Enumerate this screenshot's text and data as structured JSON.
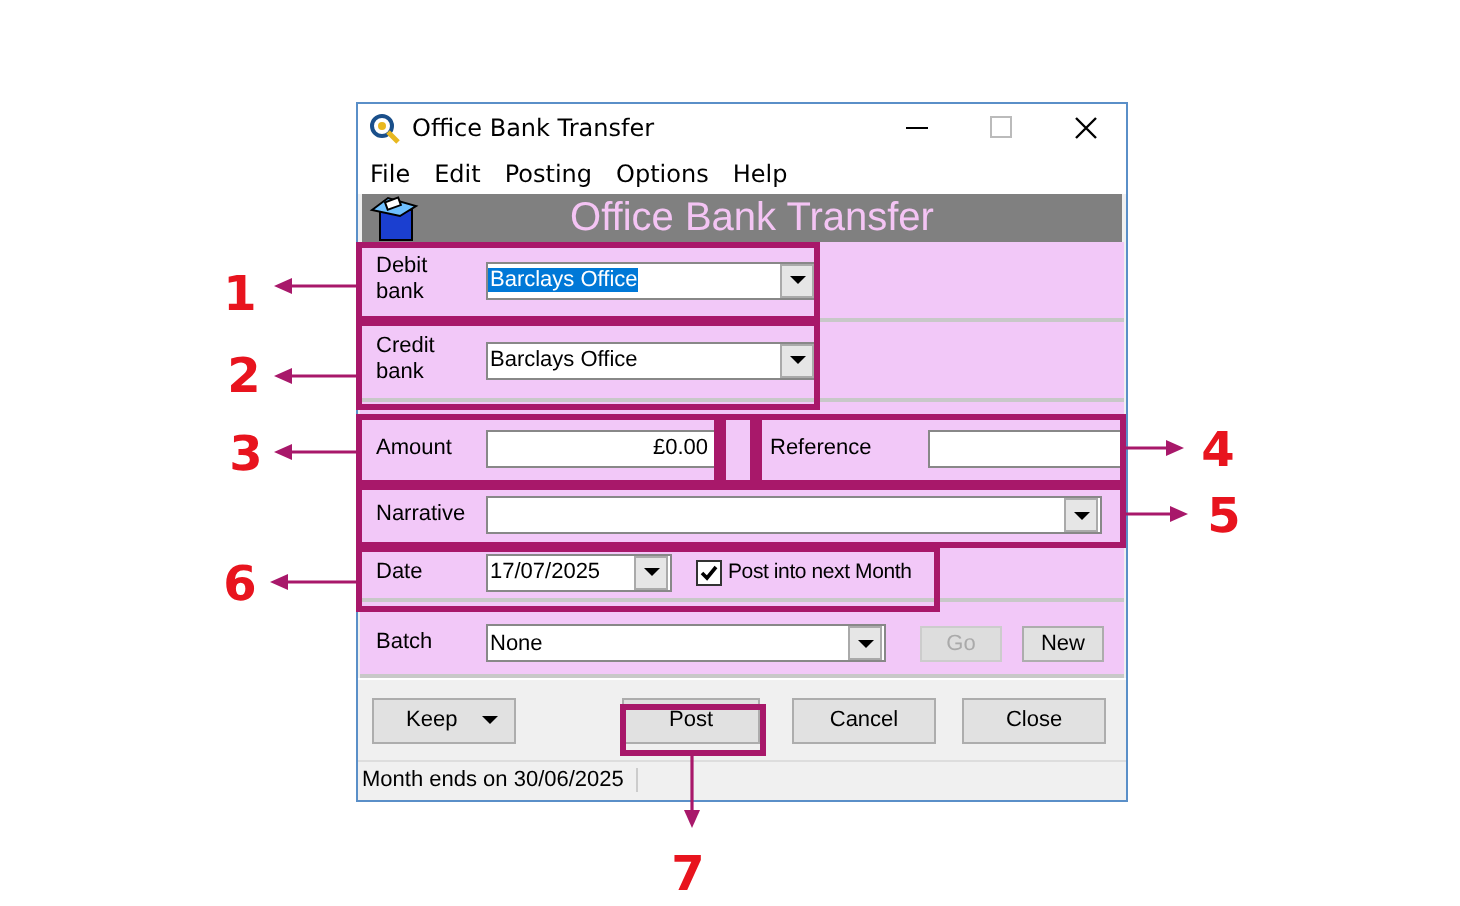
{
  "window": {
    "title": "Office Bank Transfer"
  },
  "menu": [
    "File",
    "Edit",
    "Posting",
    "Options",
    "Help"
  ],
  "banner": {
    "title": "Office Bank Transfer"
  },
  "debit_bank": {
    "label": "Debit bank",
    "value": "Barclays Office",
    "highlighted": true
  },
  "credit_bank": {
    "label": "Credit bank",
    "value": "Barclays Office",
    "highlighted": false
  },
  "amount": {
    "label": "Amount",
    "value": "£0.00"
  },
  "reference": {
    "label": "Reference"
  },
  "narrative": {
    "label": "Narrative"
  },
  "date": {
    "label": "Date",
    "value": "17/07/2025"
  },
  "post_next_month": {
    "label": "Post into next Month",
    "checked": true
  },
  "batch": {
    "label": "Batch",
    "value": "None"
  },
  "batch_buttons": [
    {
      "label": "Go",
      "disabled": true
    },
    {
      "label": "New",
      "disabled": false
    }
  ],
  "buttons": [
    {
      "label": "Keep",
      "kind": "split"
    },
    {
      "label": "Post",
      "kind": "plain"
    },
    {
      "label": "Cancel",
      "kind": "plain"
    },
    {
      "label": "Close",
      "kind": "plain"
    }
  ],
  "status_bar": "Month ends on 30/06/2025",
  "annotations": [
    "1",
    "2",
    "3",
    "4",
    "5",
    "6",
    "7"
  ]
}
